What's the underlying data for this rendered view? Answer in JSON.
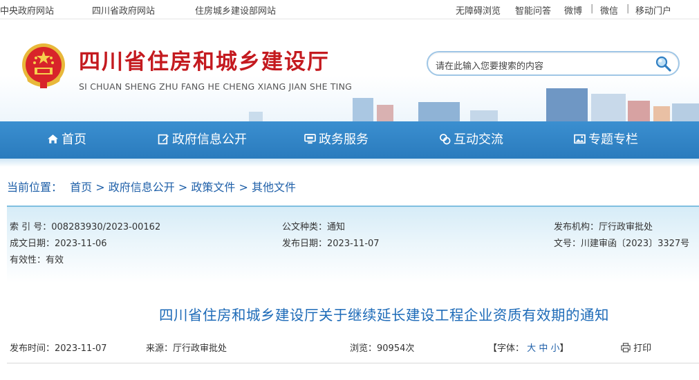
{
  "topbar": {
    "left_links": [
      "中央政府网站",
      "四川省政府网站",
      "住房城乡建设部网站"
    ],
    "right_links": [
      "无障碍浏览",
      "智能问答",
      "微博",
      "微信",
      "移动门户"
    ],
    "separator": "|"
  },
  "header": {
    "title": "四川省住房和城乡建设厅",
    "subtitle": "SI CHUAN SHENG ZHU FANG HE CHENG XIANG JIAN SHE TING",
    "search_placeholder": "请在此输入您要搜索的内容"
  },
  "nav": {
    "items": [
      {
        "label": "首页",
        "icon": "home-icon"
      },
      {
        "label": "政府信息公开",
        "icon": "edit-icon"
      },
      {
        "label": "政务服务",
        "icon": "monitor-icon"
      },
      {
        "label": "互动交流",
        "icon": "chat-icon"
      },
      {
        "label": "专题专栏",
        "icon": "image-icon"
      }
    ]
  },
  "breadcrumb": {
    "prefix": "当前位置：",
    "items": [
      "首页",
      "政府信息公开",
      "政策文件",
      "其他文件"
    ],
    "sep": ">"
  },
  "meta": {
    "index_no": "索 引 号：008283930/2023-00162",
    "doc_type": "公文种类：通知",
    "publisher": "发布机构：厅行政审批处",
    "created": "成文日期：2023-11-06",
    "published": "发布日期：2023-11-07",
    "doc_no": "文号：川建审函〔2023〕3327号",
    "validity": "有效性：有效"
  },
  "article": {
    "title": "四川省住房和城乡建设厅关于继续延长建设工程企业资质有效期的通知",
    "publish_time": "发布时间：2023-11-07",
    "source": "来源：厅行政审批处",
    "views": "浏览：90954次",
    "font_label": "【字体：",
    "font_large": "大",
    "font_medium": "中",
    "font_small": "小",
    "font_close": "】",
    "print": "打印"
  },
  "colors": {
    "nav_bg": "#2a7bbd",
    "title_red": "#c41a1f",
    "link_blue": "#1e5fa8",
    "article_title": "#1e6bb8"
  }
}
